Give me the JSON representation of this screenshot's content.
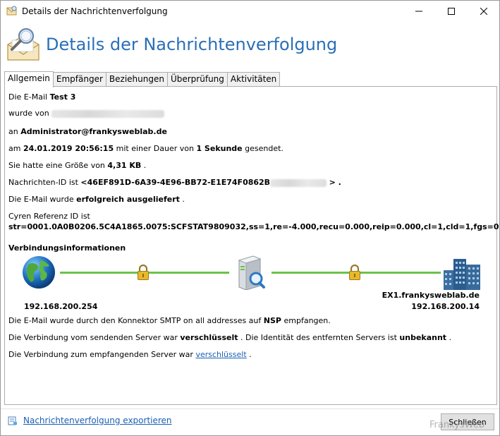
{
  "window": {
    "title": "Details der Nachrichtenverfolgung",
    "heading": "Details der Nachrichtenverfolgung"
  },
  "tabs": [
    {
      "label": "Allgemein",
      "active": true
    },
    {
      "label": "Empfänger",
      "active": false
    },
    {
      "label": "Beziehungen",
      "active": false
    },
    {
      "label": "Überprüfung",
      "active": false
    },
    {
      "label": "Aktivitäten",
      "active": false
    }
  ],
  "general": {
    "subject_prefix": "Die E-Mail",
    "subject": "Test 3",
    "from_prefix": "wurde von",
    "to_prefix": "an",
    "to": "Administrator@frankysweblab.de",
    "date_prefix": "am",
    "date": "24.01.2019 20:56:15",
    "duration_mid": "mit einer Dauer von",
    "duration": "1 Sekunde",
    "duration_suffix": "gesendet.",
    "size_prefix": "Sie hatte eine Größe von",
    "size": "4,31 KB",
    "size_suffix": ".",
    "msgid_prefix": "Nachrichten-ID ist",
    "msgid": "<46EF891D-6A39-4E96-BB72-E1E74F0862B",
    "msgid_suffix": "> .",
    "status_prefix": "Die E-Mail wurde",
    "status": "erfolgreich ausgeliefert",
    "status_suffix": ".",
    "cyren_label": "Cyren Referenz ID ist",
    "cyren_id": "str=0001.0A0B0206.5C4A1865.0075:SCFSTAT9809032,ss=1,re=-4.000,recu=0.000,reip=0.000,cl=1,cld=1,fgs=0",
    "cyren_suffix": "."
  },
  "connection": {
    "title": "Verbindungsinformationen",
    "source_ip": "192.168.200.254",
    "target_name": "EX1.frankysweblab.de",
    "target_ip": "192.168.200.14",
    "connector_prefix": "Die E-Mail wurde durch den Konnektor SMTP on all addresses auf",
    "connector_server": "NSP",
    "connector_suffix": "empfangen.",
    "send_prefix": "Die Verbindung vom sendenden Server war",
    "send_state": "verschlüsselt",
    "identity_mid": ". Die Identität des entfernten Servers ist",
    "identity_state": "unbekannt",
    "identity_suffix": ".",
    "recv_prefix": "Die Verbindung zum empfangenden Server war",
    "recv_state": "verschlüsselt",
    "recv_suffix": ".",
    "line_color": "#6cc24a"
  },
  "footer": {
    "export_link": "Nachrichtenverfolgung exportieren",
    "close_button": "Schließen",
    "watermark": "FrankysWeb"
  },
  "colors": {
    "heading": "#2a6fb7",
    "link": "#1a5fb4"
  }
}
